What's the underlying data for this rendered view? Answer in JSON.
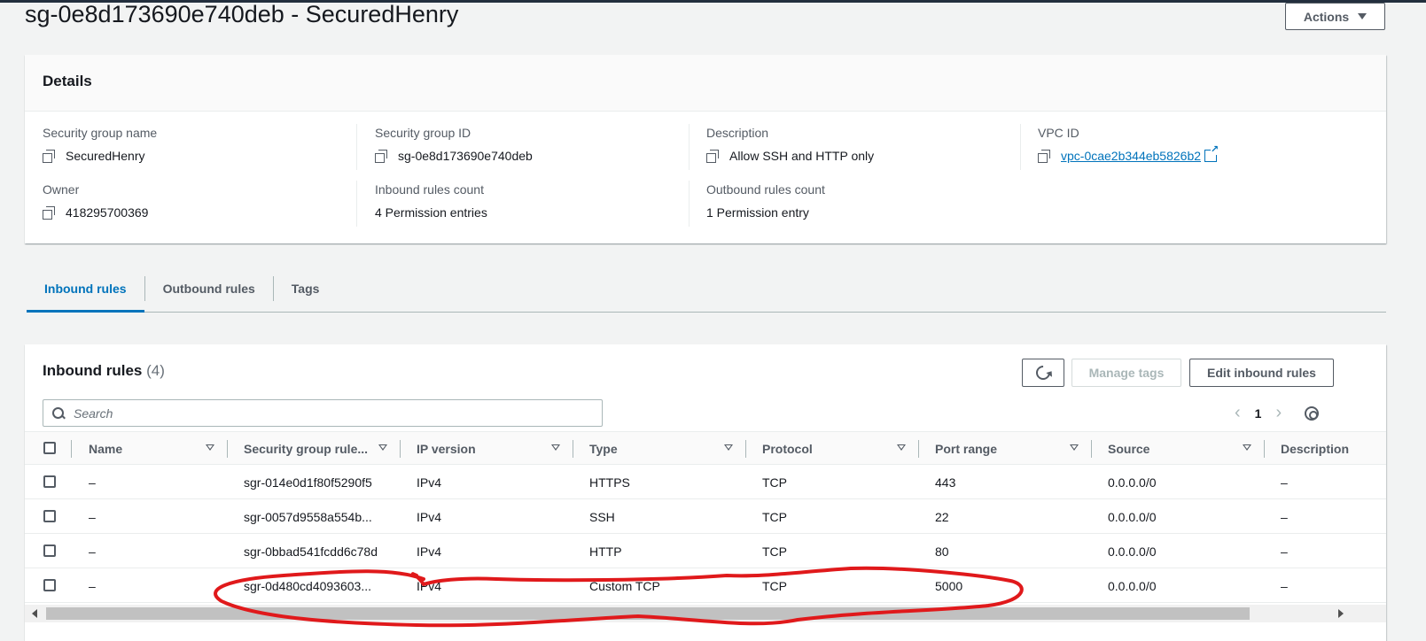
{
  "page": {
    "title": "sg-0e8d173690e740deb - SecuredHenry",
    "actions_label": "Actions"
  },
  "details": {
    "heading": "Details",
    "fields": {
      "sg_name": {
        "label": "Security group name",
        "value": "SecuredHenry"
      },
      "sg_id": {
        "label": "Security group ID",
        "value": "sg-0e8d173690e740deb"
      },
      "description": {
        "label": "Description",
        "value": "Allow SSH and HTTP only"
      },
      "vpc_id": {
        "label": "VPC ID",
        "value": "vpc-0cae2b344eb5826b2"
      },
      "owner": {
        "label": "Owner",
        "value": "418295700369"
      },
      "inbound_count": {
        "label": "Inbound rules count",
        "value": "4 Permission entries"
      },
      "outbound_count": {
        "label": "Outbound rules count",
        "value": "1 Permission entry"
      }
    }
  },
  "tabs": [
    {
      "label": "Inbound rules",
      "active": true
    },
    {
      "label": "Outbound rules",
      "active": false
    },
    {
      "label": "Tags",
      "active": false
    }
  ],
  "rules": {
    "title": "Inbound rules",
    "count": "(4)",
    "manage_tags_label": "Manage tags",
    "edit_label": "Edit inbound rules",
    "search_placeholder": "Search",
    "page_number": "1",
    "columns": [
      "Name",
      "Security group rule...",
      "IP version",
      "Type",
      "Protocol",
      "Port range",
      "Source",
      "Description"
    ],
    "rows": [
      {
        "name": "–",
        "rule_id": "sgr-014e0d1f80f5290f5",
        "ip_version": "IPv4",
        "type": "HTTPS",
        "protocol": "TCP",
        "port_range": "443",
        "source": "0.0.0.0/0",
        "description": "–"
      },
      {
        "name": "–",
        "rule_id": "sgr-0057d9558a554b...",
        "ip_version": "IPv4",
        "type": "SSH",
        "protocol": "TCP",
        "port_range": "22",
        "source": "0.0.0.0/0",
        "description": "–"
      },
      {
        "name": "–",
        "rule_id": "sgr-0bbad541fcdd6c78d",
        "ip_version": "IPv4",
        "type": "HTTP",
        "protocol": "TCP",
        "port_range": "80",
        "source": "0.0.0.0/0",
        "description": "–"
      },
      {
        "name": "–",
        "rule_id": "sgr-0d480cd4093603...",
        "ip_version": "IPv4",
        "type": "Custom TCP",
        "protocol": "TCP",
        "port_range": "5000",
        "source": "0.0.0.0/0",
        "description": "–"
      }
    ]
  },
  "colors": {
    "accent": "#0073bb",
    "annotation": "#e0191b"
  },
  "icons": [
    "copy-icon",
    "external-link-icon",
    "refresh-icon",
    "search-icon",
    "chevron-left-icon",
    "chevron-right-icon",
    "gear-icon",
    "sort-icon",
    "caret-down-icon"
  ]
}
